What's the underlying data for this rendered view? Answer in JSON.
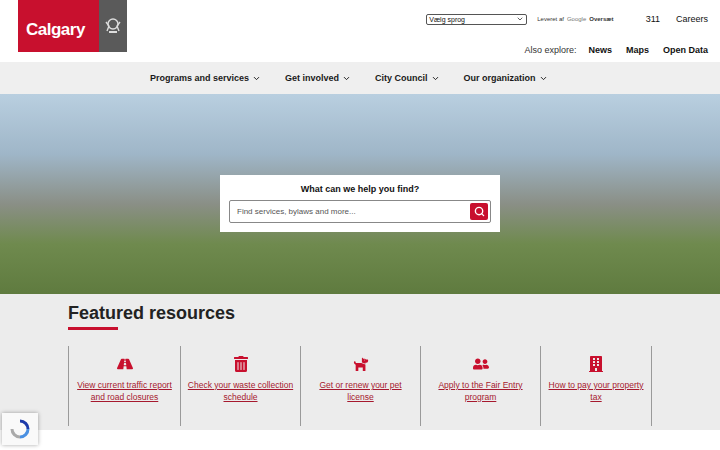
{
  "logo": {
    "text": "Calgary"
  },
  "language": {
    "select": "Vælg sprog",
    "powered_by": "Leveret af",
    "google": "Google",
    "translate": "Oversæt"
  },
  "top_links": [
    "311",
    "Careers"
  ],
  "also_explore": {
    "label": "Also explore:",
    "links": [
      "News",
      "Maps",
      "Open Data"
    ]
  },
  "nav": [
    "Programs and services",
    "Get involved",
    "City Council",
    "Our organization"
  ],
  "search": {
    "title": "What can we help you find?",
    "placeholder": "Find services, bylaws and more..."
  },
  "featured": {
    "title": "Featured resources",
    "items": [
      {
        "label": "View current traffic report and road closures",
        "kind": "traffic"
      },
      {
        "label": "Check your waste collection schedule",
        "kind": "waste"
      },
      {
        "label": "Get or renew your pet license",
        "kind": "pet"
      },
      {
        "label": "Apply to the Fair Entry program",
        "kind": "people"
      },
      {
        "label": "How to pay your property tax",
        "kind": "building"
      }
    ]
  }
}
